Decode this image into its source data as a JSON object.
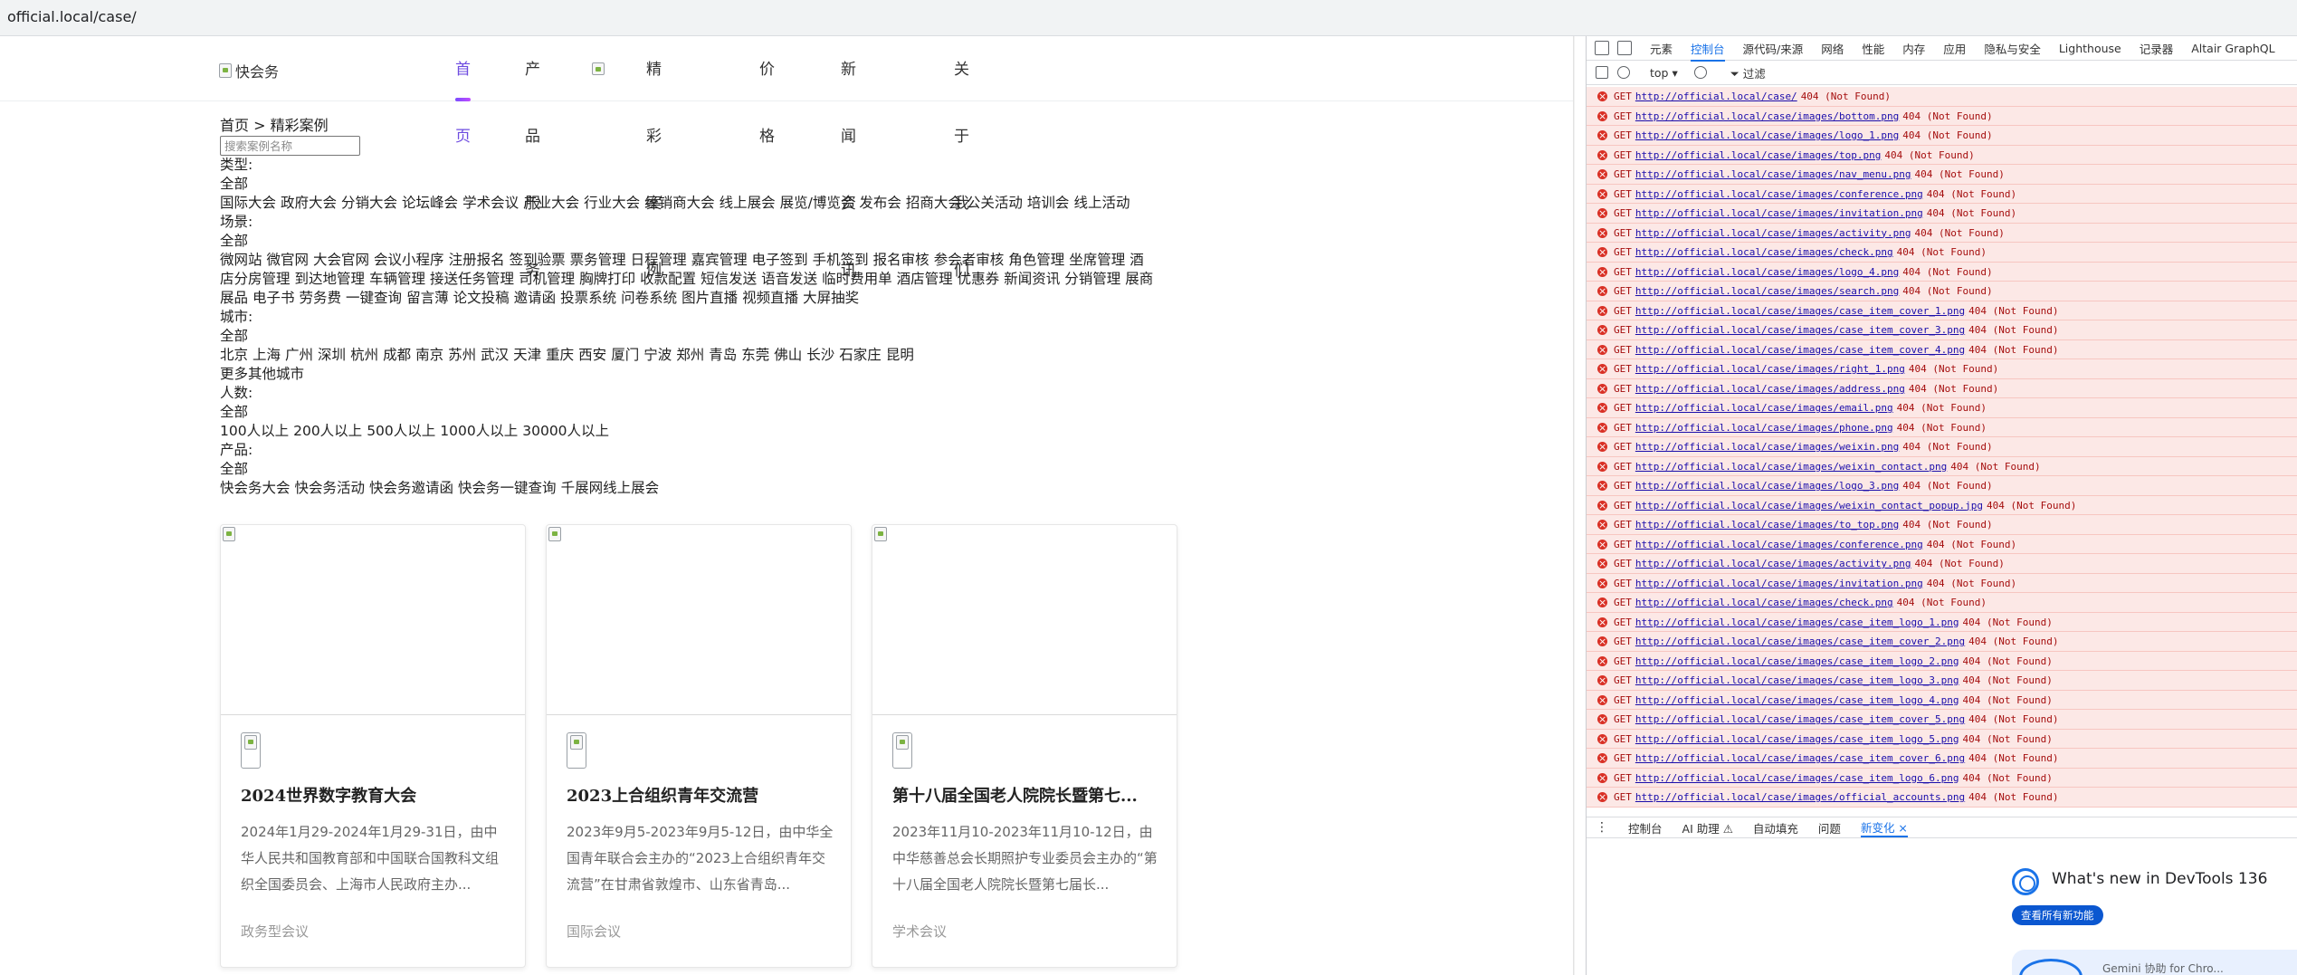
{
  "address_bar": {
    "url": "official.local/case/"
  },
  "site": {
    "logo_alt": "快会务",
    "nav": [
      "首页",
      "产品服务",
      "精彩案例",
      "价格",
      "新闻资讯",
      "关于我们"
    ],
    "active_nav": 0
  },
  "breadcrumb": "首页 > 精彩案例",
  "search": {
    "placeholder": "搜索案例名称",
    "value": ""
  },
  "filters": {
    "type": {
      "label": "类型:",
      "all": "全部",
      "options": [
        "国际大会",
        "政府大会",
        "分销大会",
        "论坛峰会",
        "学术会议",
        "产业大会",
        "行业大会",
        "经销商大会",
        "线上展会",
        "展览/博览会",
        "发布会",
        "招商大会",
        "公关活动",
        "培训会",
        "线上活动"
      ]
    },
    "scene": {
      "label": "场景:",
      "all": "全部",
      "options_line1": [
        "微网站",
        "微官网",
        "大会官网",
        "会议小程序",
        "注册报名",
        "签到验票",
        "票务管理",
        "日程管理",
        "嘉宾管理",
        "电子签到",
        "手机签到",
        "报名审核",
        "参会者审核",
        "角色管理",
        "坐席管理",
        "酒"
      ],
      "options_line2": [
        "店分房管理",
        "到达地管理",
        "车辆管理",
        "接送任务管理",
        "司机管理",
        "胸牌打印",
        "收款配置",
        "短信发送",
        "语音发送",
        "临时费用单",
        "酒店管理",
        "优惠券",
        "新闻资讯",
        "分销管理",
        "展商"
      ],
      "options_line3": [
        "展品",
        "电子书",
        "劳务费",
        "一键查询",
        "留言薄",
        "论文投稿",
        "邀请函",
        "投票系统",
        "问卷系统",
        "图片直播",
        "视频直播",
        "大屏抽奖"
      ]
    },
    "city": {
      "label": "城市:",
      "all": "全部",
      "options": [
        "北京",
        "上海",
        "广州",
        "深圳",
        "杭州",
        "成都",
        "南京",
        "苏州",
        "武汉",
        "天津",
        "重庆",
        "西安",
        "厦门",
        "宁波",
        "郑州",
        "青岛",
        "东莞",
        "佛山",
        "长沙",
        "石家庄",
        "昆明"
      ],
      "more": "更多其他城市"
    },
    "people": {
      "label": "人数:",
      "all": "全部",
      "options": [
        "100人以上",
        "200人以上",
        "500人以上",
        "1000人以上",
        "30000人以上"
      ]
    },
    "product": {
      "label": "产品:",
      "all": "全部",
      "options": [
        "快会务大会",
        "快会务活动",
        "快会务邀请函",
        "快会务一键查询",
        "千展网线上展会"
      ]
    }
  },
  "cases": [
    {
      "title": "2024世界数字教育大会",
      "desc": "2024年1月29-2024年1月29-31日，由中华人民共和国教育部和中国联合国教科文组织全国委员会、上海市人民政府主办...",
      "tag": "政务型会议"
    },
    {
      "title": "2023上合组织青年交流营",
      "desc": "2023年9月5-2023年9月5-12日，由中华全国青年联合会主办的“2023上合组织青年交流营”在甘肃省敦煌市、山东省青岛...",
      "tag": "国际会议"
    },
    {
      "title": "第十八届全国老人院院长暨第七...",
      "desc": "2023年11月10-2023年11月10-12日，由中华慈善总会长期照护专业委员会主办的“第十八届全国老人院院长暨第七届长...",
      "tag": "学术会议"
    }
  ],
  "devtools": {
    "tabs": [
      "元素",
      "控制台",
      "源代码/来源",
      "网络",
      "性能",
      "内存",
      "应用",
      "隐私与安全",
      "Lighthouse",
      "记录器",
      "Altair GraphQL"
    ],
    "active_tab": 1,
    "toolbar": {
      "context": "top ▾",
      "filter": "过滤"
    },
    "logs": [
      "http://official.local/case/",
      "http://official.local/case/images/bottom.png",
      "http://official.local/case/images/logo_1.png",
      "http://official.local/case/images/top.png",
      "http://official.local/case/images/nav_menu.png",
      "http://official.local/case/images/conference.png",
      "http://official.local/case/images/invitation.png",
      "http://official.local/case/images/activity.png",
      "http://official.local/case/images/check.png",
      "http://official.local/case/images/logo_4.png",
      "http://official.local/case/images/search.png",
      "http://official.local/case/images/case_item_cover_1.png",
      "http://official.local/case/images/case_item_cover_3.png",
      "http://official.local/case/images/case_item_cover_4.png",
      "http://official.local/case/images/right_1.png",
      "http://official.local/case/images/address.png",
      "http://official.local/case/images/email.png",
      "http://official.local/case/images/phone.png",
      "http://official.local/case/images/weixin.png",
      "http://official.local/case/images/weixin_contact.png",
      "http://official.local/case/images/logo_3.png",
      "http://official.local/case/images/weixin_contact_popup.jpg",
      "http://official.local/case/images/to_top.png",
      "http://official.local/case/images/conference.png",
      "http://official.local/case/images/activity.png",
      "http://official.local/case/images/invitation.png",
      "http://official.local/case/images/check.png",
      "http://official.local/case/images/case_item_logo_1.png",
      "http://official.local/case/images/case_item_cover_2.png",
      "http://official.local/case/images/case_item_logo_2.png",
      "http://official.local/case/images/case_item_logo_3.png",
      "http://official.local/case/images/case_item_logo_4.png",
      "http://official.local/case/images/case_item_cover_5.png",
      "http://official.local/case/images/case_item_logo_5.png",
      "http://official.local/case/images/case_item_cover_6.png",
      "http://official.local/case/images/case_item_logo_6.png",
      "http://official.local/case/images/official_accounts.png"
    ],
    "log_method": "GET",
    "log_status": "404 (Not Found)",
    "drawer_tabs": [
      "控制台",
      "AI 助理 ⚠",
      "自动填充",
      "问题",
      "新变化 ×"
    ],
    "active_drawer_tab": 4,
    "whats_new": {
      "title": "What's new in DevTools 136",
      "button": "查看所有新功能",
      "card_text": "Gemini 协助 for Chro..."
    }
  }
}
